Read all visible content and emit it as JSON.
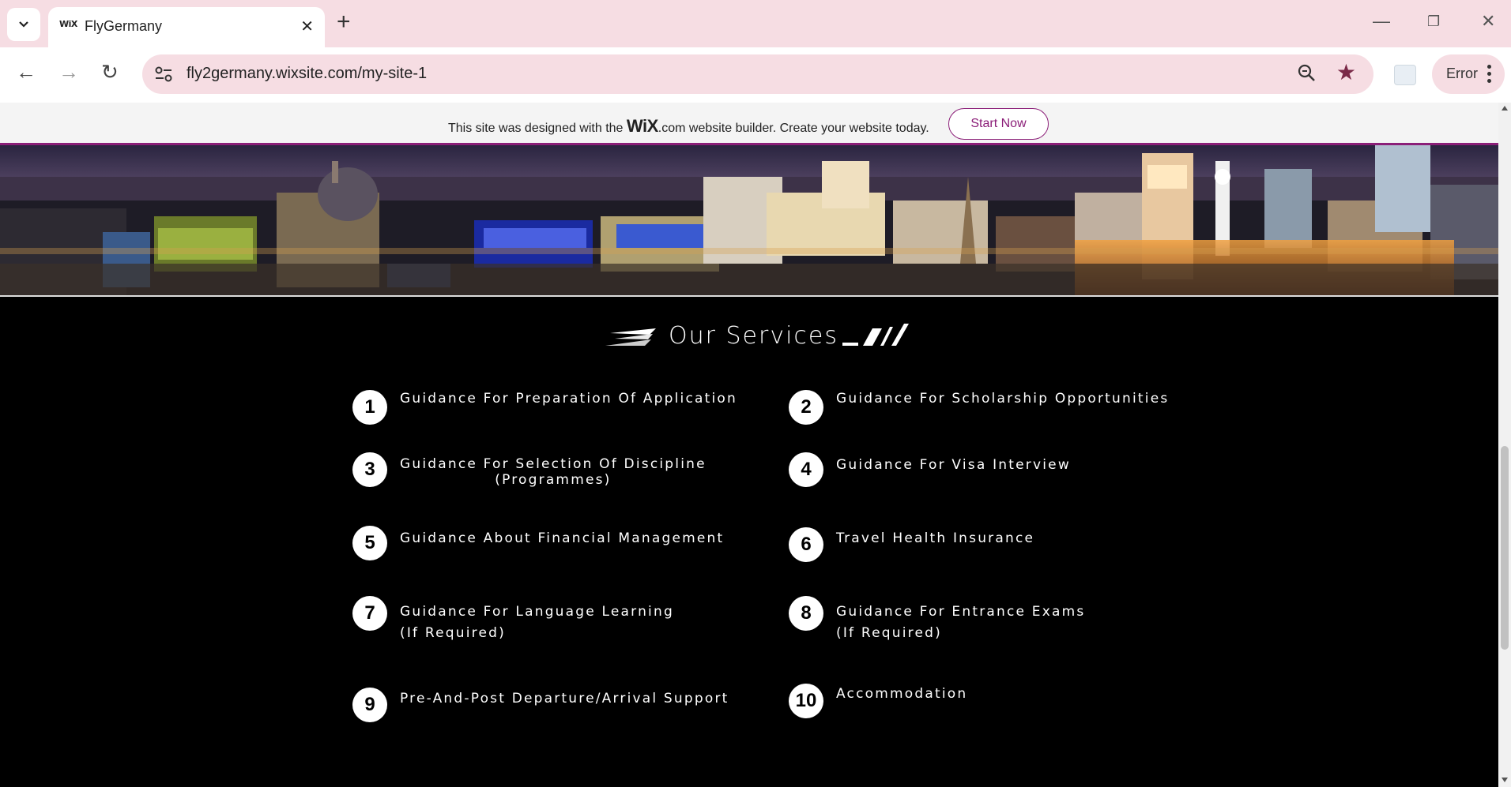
{
  "browser": {
    "tab_title": "FlyGermany",
    "tab_favicon": "WiX",
    "url": "fly2germany.wixsite.com/my-site-1",
    "profile_status": "Error"
  },
  "wix_banner": {
    "text_before": "This site was designed with the",
    "logo_text": "WiX",
    "text_after": ".com website builder. Create your website today.",
    "button_label": "Start Now"
  },
  "services": {
    "title": "Our Services",
    "items": [
      {
        "number": "1",
        "label": "Guidance For Preparation Of Application"
      },
      {
        "number": "2",
        "label": "Guidance For Scholarship Opportunities"
      },
      {
        "number": "3",
        "label_line1": "Guidance For Selection Of Discipline",
        "label_line2": "(Programmes)"
      },
      {
        "number": "4",
        "label": "Guidance For Visa Interview"
      },
      {
        "number": "5",
        "label": "Guidance About Financial Management"
      },
      {
        "number": "6",
        "label": "Travel Health Insurance"
      },
      {
        "number": "7",
        "label_line1": "Guidance For Language Learning",
        "label_line2": "(If Required)"
      },
      {
        "number": "8",
        "label_line1": "Guidance For Entrance Exams",
        "label_line2": "(If Required)"
      },
      {
        "number": "9",
        "label": "Pre-And-Post Departure/Arrival Support"
      },
      {
        "number": "10",
        "label": "Accommodation"
      }
    ]
  },
  "colors": {
    "accent": "#8b1e78",
    "tabstrip": "#f6dde3",
    "page_bg": "#000000"
  }
}
